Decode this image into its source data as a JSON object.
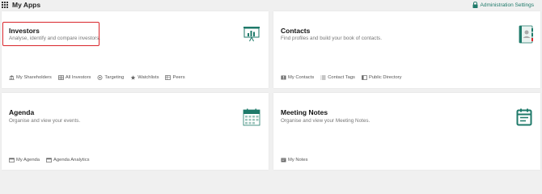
{
  "header": {
    "title": "My Apps",
    "admin_label": "Administration Settings"
  },
  "colors": {
    "accent": "#1f7a6a",
    "highlight": "#d9252b"
  },
  "cards": {
    "investors": {
      "title": "Investors",
      "description": "Analyse, identify and compare investors.",
      "links": [
        "My Shareholders",
        "All Investors",
        "Targeting",
        "Watchlists",
        "Peers"
      ]
    },
    "contacts": {
      "title": "Contacts",
      "description": "Find profiles and build your book of contacts.",
      "links": [
        "My Contacts",
        "Contact Tags",
        "Public Directory"
      ]
    },
    "agenda": {
      "title": "Agenda",
      "description": "Organise and view your events.",
      "links": [
        "My Agenda",
        "Agenda Analytics"
      ]
    },
    "meeting_notes": {
      "title": "Meeting Notes",
      "description": "Organise and view your Meeting Notes.",
      "links": [
        "My Notes"
      ]
    }
  }
}
